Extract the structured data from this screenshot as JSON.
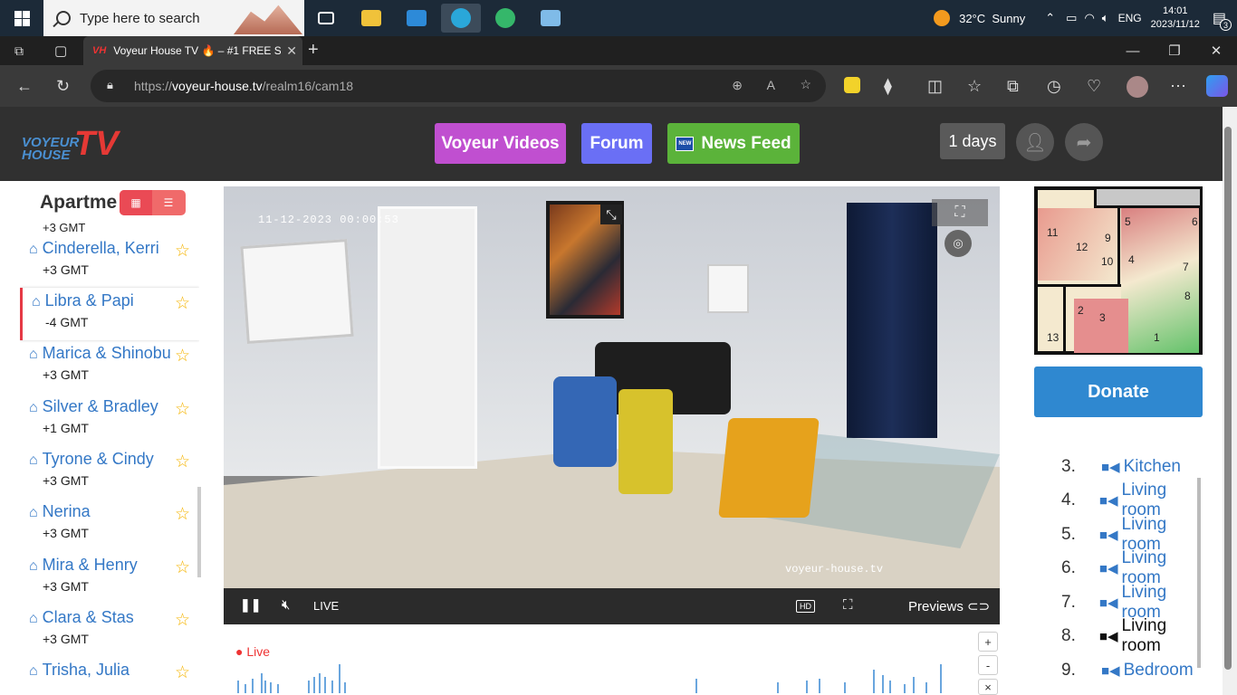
{
  "taskbar": {
    "search_placeholder": "Type here to search",
    "weather_temp": "32°C",
    "weather_text": "Sunny",
    "lang": "ENG",
    "time": "14:01",
    "date": "2023/11/12",
    "notif_count": "3"
  },
  "browser": {
    "tab_title": "Voyeur House TV 🔥 – #1 FREE S",
    "url_scheme": "https://",
    "url_host": "voyeur-house.tv",
    "url_path": "/realm16/cam18"
  },
  "header": {
    "logo_top": "VOYEUR",
    "logo_bottom": "HOUSE",
    "logo_tv": "TV",
    "btn_videos": "Voyeur Videos",
    "btn_forum": "Forum",
    "btn_news": "News Feed",
    "news_badge": "NEW",
    "days": "1 days",
    "colors": {
      "videos": "#c04fd0",
      "forum": "#6a6ff5",
      "news": "#5bb33a"
    }
  },
  "sidebar": {
    "title": "Apartme",
    "top_tz": "+3 GMT",
    "items": [
      {
        "name": "Cinderella, Kerri",
        "tz": "+3 GMT"
      },
      {
        "name": "Libra & Papi",
        "tz": "-4 GMT"
      },
      {
        "name": "Marica & Shinobu",
        "tz": "+3 GMT"
      },
      {
        "name": "Silver & Bradley",
        "tz": "+1 GMT"
      },
      {
        "name": "Tyrone & Cindy",
        "tz": "+3 GMT"
      },
      {
        "name": "Nerina",
        "tz": "+3 GMT"
      },
      {
        "name": "Mira & Henry",
        "tz": "+3 GMT"
      },
      {
        "name": "Clara & Stas",
        "tz": "+3 GMT"
      },
      {
        "name": "Trisha, Julia",
        "tz": ""
      }
    ]
  },
  "video": {
    "timestamp": "11-12-2023 00:00:53",
    "watermark": "voyeur-house.tv",
    "live_label": "LIVE",
    "hd_label": "HD",
    "previews_label": "Previews"
  },
  "timeline": {
    "live_label": "Live",
    "zoom_in": "+",
    "zoom_out": "-",
    "close": "×"
  },
  "floorplan": {
    "labels": [
      "11",
      "12",
      "9",
      "10",
      "5",
      "6",
      "4",
      "7",
      "8",
      "2",
      "3",
      "13",
      "1"
    ]
  },
  "donate_label": "Donate",
  "cameras": [
    {
      "num": "3.",
      "name": "Kitchen"
    },
    {
      "num": "4.",
      "name": "Living room"
    },
    {
      "num": "5.",
      "name": "Living room"
    },
    {
      "num": "6.",
      "name": "Living room"
    },
    {
      "num": "7.",
      "name": "Living room"
    },
    {
      "num": "8.",
      "name": "Living room"
    },
    {
      "num": "9.",
      "name": "Bedroom"
    }
  ]
}
